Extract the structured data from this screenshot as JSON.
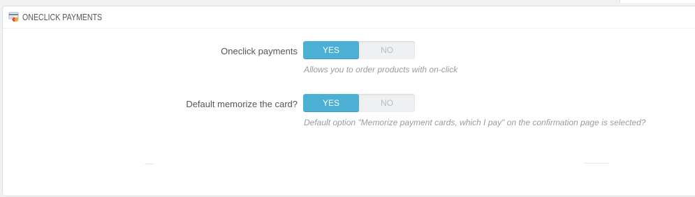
{
  "panel": {
    "title": "ONECLICK PAYMENTS",
    "icon": "payment-cards-icon"
  },
  "fields": [
    {
      "label": "Oneclick payments",
      "yes_label": "YES",
      "no_label": "NO",
      "value": "YES",
      "help": "Allows you to order products with on-click"
    },
    {
      "label": "Default memorize the card?",
      "yes_label": "YES",
      "no_label": "NO",
      "value": "YES",
      "help": "Default option \"Memorize payment cards, which I pay\" on the confirmation page is selected?"
    }
  ],
  "colors": {
    "accent": "#4bb0d4",
    "label": "#555555",
    "help": "#959da2"
  }
}
